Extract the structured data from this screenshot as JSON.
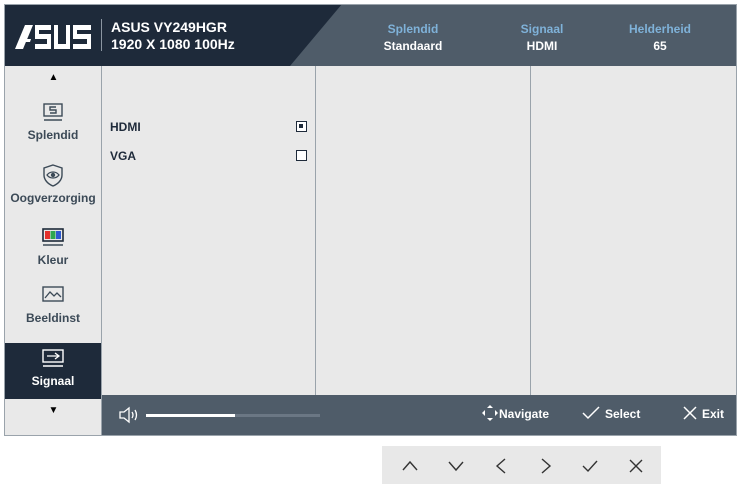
{
  "header": {
    "model_name": "ASUS VY249HGR",
    "model_res": "1920 X 1080 100Hz",
    "info": [
      {
        "label": "Splendid",
        "value": "Standaard"
      },
      {
        "label": "Signaal",
        "value": "HDMI"
      },
      {
        "label": "Helderheid",
        "value": "65"
      }
    ]
  },
  "sidebar": {
    "items": [
      {
        "label": "Splendid",
        "icon": "splendid-icon"
      },
      {
        "label": "Oogverzorging",
        "icon": "eye-icon"
      },
      {
        "label": "Kleur",
        "icon": "color-icon"
      },
      {
        "label": "Beeldinst",
        "icon": "image-icon"
      },
      {
        "label": "Signaal",
        "icon": "input-icon",
        "active": true
      }
    ]
  },
  "options": [
    {
      "label": "HDMI",
      "checked": true
    },
    {
      "label": "VGA",
      "checked": false
    }
  ],
  "bottom": {
    "volume_fraction": 0.51,
    "navigate": "Navigate",
    "select": "Select",
    "exit": "Exit"
  },
  "colors": {
    "header_dark": "#1e2a3a",
    "header_slate": "#4f5c69",
    "accent_blue": "#7fb2d9",
    "panel_bg": "#e9e9e9"
  }
}
